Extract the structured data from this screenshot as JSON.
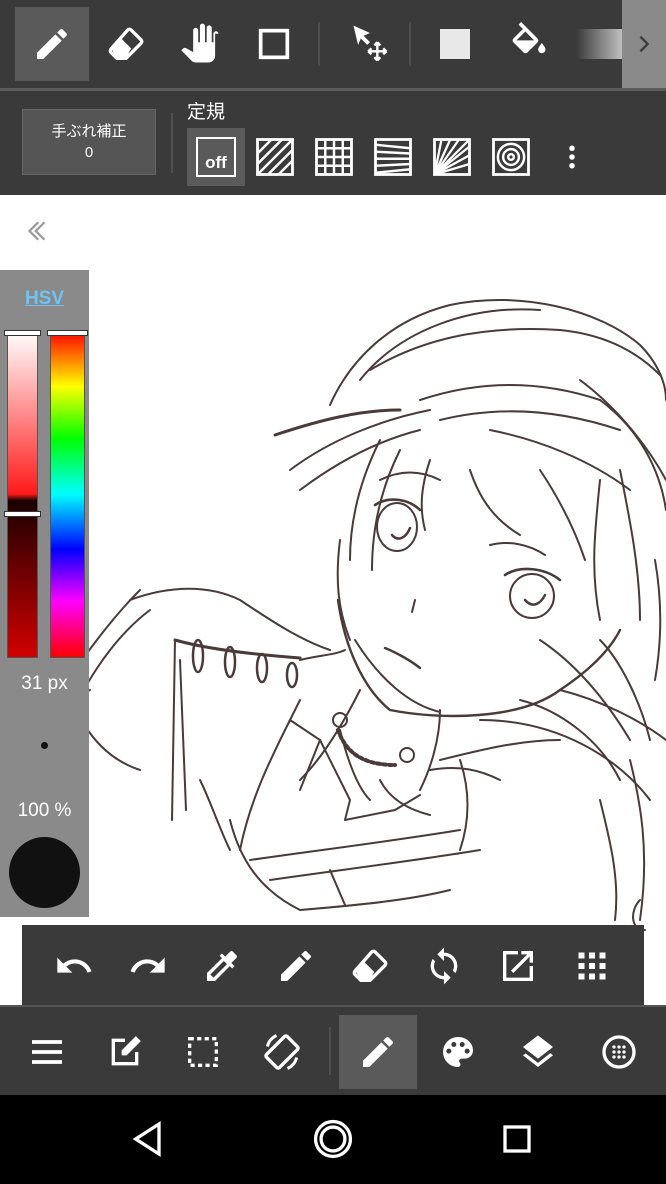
{
  "top_toolbar": {
    "tools": [
      {
        "icon": "pen-icon",
        "selected": true
      },
      {
        "icon": "eraser-icon",
        "selected": false
      },
      {
        "icon": "hand-icon",
        "selected": false
      },
      {
        "icon": "rectangle-select-icon",
        "selected": false
      },
      {
        "icon": "move-transform-icon",
        "selected": false
      },
      {
        "icon": "fill-rectangle-icon",
        "selected": false
      },
      {
        "icon": "bucket-icon",
        "selected": false
      },
      {
        "icon": "gradient-icon",
        "selected": false
      }
    ],
    "expand_icon": "chevron-right-icon"
  },
  "ruler_bar": {
    "stabilizer_label": "手ぶれ補正",
    "stabilizer_value": "0",
    "ruler_label": "定規",
    "ruler_off_label": "off",
    "ruler_options": [
      "off",
      "parallel-lines",
      "grid",
      "perspective-lines",
      "radial-lines",
      "concentric-circles"
    ],
    "more_icon": "more-vertical-icon"
  },
  "color_panel": {
    "mode_label": "HSV",
    "size_value": "31 px",
    "opacity_value": "100 %",
    "brush_size_px": 31,
    "opacity_percent": 100,
    "current_color": "#111111",
    "saturation_value_level": 0.55,
    "hue_level": 0.0
  },
  "quick_bar": {
    "buttons": [
      "undo-icon",
      "redo-icon",
      "eyedropper-icon",
      "pen-icon",
      "eraser-icon",
      "rotate-icon",
      "export-icon",
      "grid-menu-icon"
    ]
  },
  "bottom_bar": {
    "buttons": [
      "menu-icon",
      "edit-icon",
      "selection-icon",
      "canvas-rotate-icon",
      "brush-icon",
      "palette-icon",
      "layers-icon",
      "material-icon"
    ],
    "selected": "brush-icon"
  },
  "android_nav": {
    "buttons": [
      "back-icon",
      "home-icon",
      "recents-icon"
    ]
  },
  "colors": {
    "toolbar_bg": "#3a3a3a",
    "selected_bg": "#5a5a5a",
    "panel_bg": "#8a8a8a",
    "hsv_accent": "#6fc3f5",
    "sketch_line": "#4a3a3a"
  }
}
